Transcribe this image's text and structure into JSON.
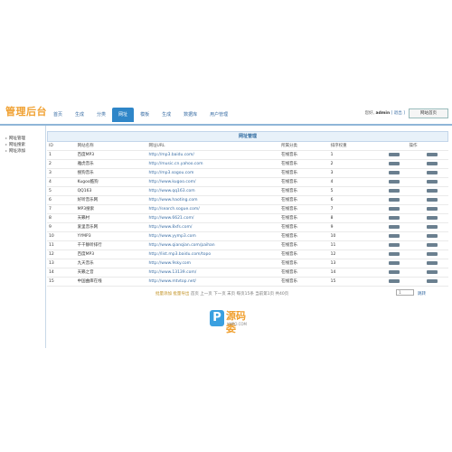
{
  "app": {
    "logo": "管理后台"
  },
  "nav": [
    {
      "label": "首页",
      "active": false
    },
    {
      "label": "生成",
      "active": false
    },
    {
      "label": "分类",
      "active": false
    },
    {
      "label": "网址",
      "active": true
    },
    {
      "label": "模板",
      "active": false
    },
    {
      "label": "生成",
      "active": false
    },
    {
      "label": "数据库",
      "active": false
    },
    {
      "label": "用户管理",
      "active": false
    }
  ],
  "user": {
    "prefix": "您好,",
    "name": "admin",
    "logout": "[ 退出 ]",
    "home_button": "网站首页"
  },
  "sidebar": {
    "items": [
      "网址管理",
      "网址搜索",
      "网址添加"
    ]
  },
  "panel": {
    "title": "网址管理"
  },
  "table": {
    "headers": [
      "ID",
      "网站名称",
      "网址URL",
      "所属分类",
      "排序权重",
      "操作"
    ],
    "rows": [
      {
        "id": "1",
        "name": "百度MP3",
        "url": "http://mp3.baidu.com/",
        "category": "在线音乐",
        "sort": "1"
      },
      {
        "id": "2",
        "name": "雅虎音乐",
        "url": "http://music.cn.yahoo.com",
        "category": "在线音乐",
        "sort": "2"
      },
      {
        "id": "3",
        "name": "搜狗音乐",
        "url": "http://mp3.sogou.com",
        "category": "在线音乐",
        "sort": "3"
      },
      {
        "id": "4",
        "name": "Kugoo酷狗",
        "url": "http://www.kugoo.com/",
        "category": "在线音乐",
        "sort": "4"
      },
      {
        "id": "5",
        "name": "QQ163",
        "url": "http://www.qq163.com",
        "category": "在线音乐",
        "sort": "5"
      },
      {
        "id": "6",
        "name": "好听音乐网",
        "url": "http://www.haoting.com",
        "category": "在线音乐",
        "sort": "6"
      },
      {
        "id": "7",
        "name": "MP3搜索",
        "url": "http://search.sogue.com/",
        "category": "在线音乐",
        "sort": "7"
      },
      {
        "id": "8",
        "name": "天籁村",
        "url": "http://www.6621.com/",
        "category": "在线音乐",
        "sort": "8"
      },
      {
        "id": "9",
        "name": "爱里音乐网",
        "url": "http://www.8xfs.com/",
        "category": "在线音乐",
        "sort": "9"
      },
      {
        "id": "10",
        "name": "YYMP3",
        "url": "http://www.yymp3.com",
        "category": "在线音乐",
        "sort": "10"
      },
      {
        "id": "11",
        "name": "千千静听排行",
        "url": "http://www.qianqian.com/paihan",
        "category": "在线音乐",
        "sort": "11"
      },
      {
        "id": "12",
        "name": "百度MP3",
        "url": "http://list.mp3.baidu.com/topo",
        "category": "在线音乐",
        "sort": "12"
      },
      {
        "id": "13",
        "name": "九天音乐",
        "url": "http://www.9sky.com",
        "category": "在线音乐",
        "sort": "13"
      },
      {
        "id": "14",
        "name": "天籁之音",
        "url": "http://www.13139.com/",
        "category": "在线音乐",
        "sort": "14"
      },
      {
        "id": "15",
        "name": "中国曲库在线",
        "url": "http://www.mtvtop.net/",
        "category": "在线音乐",
        "sort": "15"
      }
    ]
  },
  "pager": {
    "highlight": "批量添加 批量导出",
    "text": "首页 上一页 下一页 末页 每页15条 当前第1页 共40页",
    "jump_value": "1",
    "jump_label": "跳转"
  },
  "watermark": {
    "glyph": "P",
    "text": "源码委",
    "sub": "YMPO.COM"
  }
}
